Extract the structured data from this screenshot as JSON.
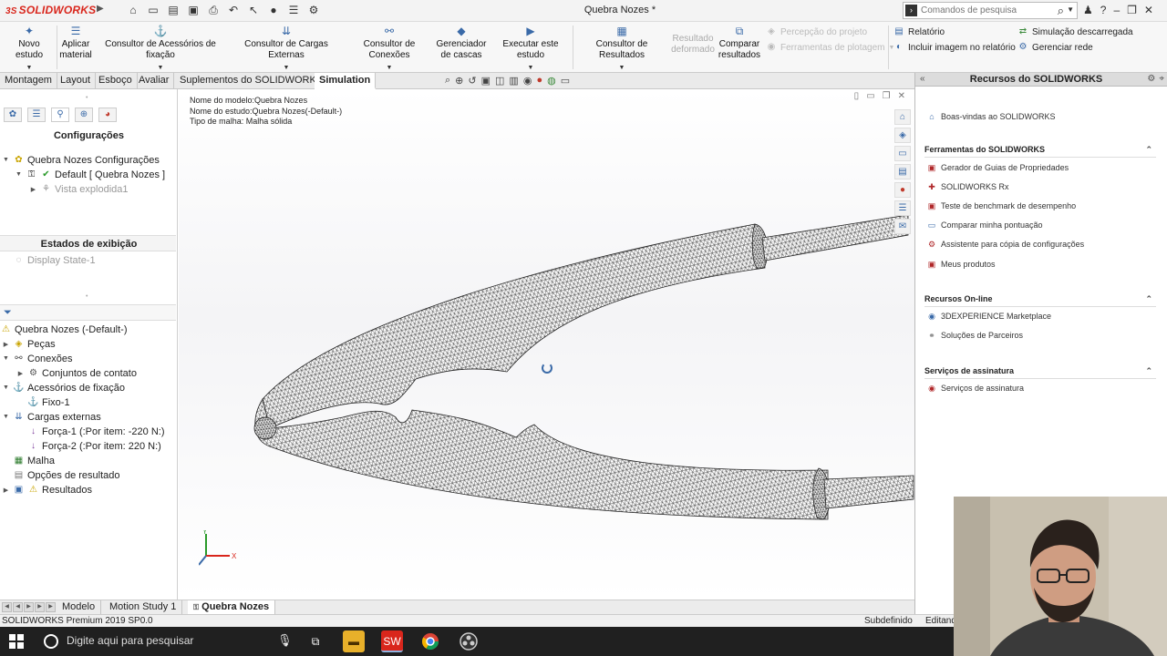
{
  "titlebar": {
    "logo_prefix": "3S",
    "logo_text": "SOLIDWORKS",
    "doc_title": "Quebra Nozes *",
    "search_placeholder": "Comandos de pesquisa",
    "window_controls": [
      "?",
      "–",
      "❐",
      "✕"
    ]
  },
  "commands": {
    "novo_estudo": "Novo estudo",
    "aplicar_material": "Aplicar material",
    "consultor_acessorios": "Consultor de Acessórios de fixação",
    "consultor_cargas": "Consultor de Cargas Externas",
    "consultor_conexoes": "Consultor de Conexões",
    "gerenciador_cascas": "Gerenciador de cascas",
    "executar_estudo": "Executar este estudo",
    "consultor_resultados": "Consultor de Resultados",
    "resultado_deformado": "Resultado deformado",
    "comparar_resultados": "Comparar resultados",
    "percepcao_projeto": "Percepção do projeto",
    "ferramentas_plotagem": "Ferramentas de plotagem",
    "relatorio": "Relatório",
    "incluir_imagem": "Incluir imagem no relatório",
    "simulacao_descarregada": "Simulação descarregada",
    "gerenciar_rede": "Gerenciar rede"
  },
  "tabs": [
    "Montagem",
    "Layout",
    "Esboço",
    "Avaliar",
    "Suplementos do SOLIDWORKS",
    "Simulation"
  ],
  "config_panel": {
    "heading": "Configurações",
    "items": [
      {
        "label": "Quebra Nozes Configurações"
      },
      {
        "label": "Default [ Quebra Nozes ]"
      },
      {
        "label": "Vista explodida1"
      }
    ],
    "display_heading": "Estados de exibição",
    "display_item": "Display State-1"
  },
  "sim_tree": [
    {
      "label": "Quebra Nozes (-Default-)"
    },
    {
      "label": "Peças"
    },
    {
      "label": "Conexões"
    },
    {
      "label": "Conjuntos de contato"
    },
    {
      "label": "Acessórios de fixação"
    },
    {
      "label": "Fixo-1"
    },
    {
      "label": "Cargas externas"
    },
    {
      "label": "Força-1 (:Por item: -220 N:)"
    },
    {
      "label": "Força-2 (:Por item: 220 N:)"
    },
    {
      "label": "Malha"
    },
    {
      "label": "Opções de resultado"
    },
    {
      "label": "Resultados"
    }
  ],
  "viewport": {
    "info": [
      "Nome do modelo:Quebra Nozes",
      "Nome do estudo:Quebra Nozes(-Default-)",
      "Tipo de malha: Malha sólida"
    ],
    "triad_x": "X",
    "triad_y": "Y"
  },
  "bottom_tabs": [
    "Modelo",
    "Motion Study 1",
    "Quebra Nozes"
  ],
  "status": {
    "left": "SOLIDWORKS Premium 2019 SP0.0",
    "definition": "Subdefinido",
    "editing": "Editand"
  },
  "taskpane": {
    "title": "Recursos do SOLIDWORKS",
    "welcome": "Boas-vindas ao SOLIDWORKS",
    "section_tools": "Ferramentas do SOLIDWORKS",
    "tools": [
      "Gerador de Guias de Propriedades",
      "SOLIDWORKS Rx",
      "Teste de benchmark de desempenho",
      "Comparar minha pontuação",
      "Assistente para cópia de configurações",
      "Meus produtos"
    ],
    "section_online": "Recursos On-line",
    "online": [
      "3DEXPERIENCE Marketplace",
      "Soluções de Parceiros"
    ],
    "section_subscription": "Serviços de assinatura",
    "subscription": [
      "Serviços de assinatura"
    ]
  },
  "taskbar": {
    "search_text": "Digite aqui para pesquisar",
    "apps": [
      "task-view",
      "file-explorer",
      "solidworks",
      "chrome",
      "obs"
    ]
  },
  "colors": {
    "brand_red": "#d9261c",
    "accent_blue": "#3a6aa8",
    "taskbar": "#202020"
  }
}
